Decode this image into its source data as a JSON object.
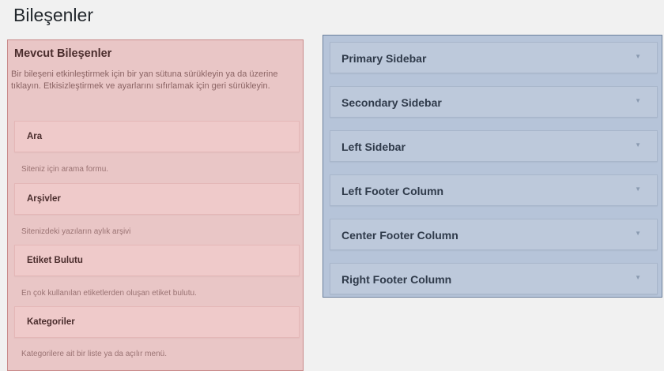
{
  "page": {
    "title": "Bileşenler"
  },
  "available": {
    "heading": "Mevcut Bileşenler",
    "description": "Bir bileşeni etkinleştirmek için bir yan sütuna sürükleyin ya da üzerine tıklayın. Etkisizleştirmek ve ayarlarını sıfırlamak için geri sürükleyin.",
    "widgets": [
      {
        "title": "Ara",
        "description": "Siteniz için arama formu."
      },
      {
        "title": "Arşivler",
        "description": "Sitenizdeki yazıların aylık arşivi"
      },
      {
        "title": "Etiket Bulutu",
        "description": "En çok kullanılan etiketlerden oluşan etiket bulutu."
      },
      {
        "title": "Kategoriler",
        "description": "Kategorilere ait bir liste ya da açılır menü."
      }
    ]
  },
  "sidebars": {
    "arrow_icon": "triangle-down-icon",
    "items": [
      {
        "label": "Primary Sidebar"
      },
      {
        "label": "Secondary Sidebar"
      },
      {
        "label": "Left Sidebar"
      },
      {
        "label": "Left Footer Column"
      },
      {
        "label": "Center Footer Column"
      },
      {
        "label": "Right Footer Column"
      }
    ]
  },
  "colors": {
    "available_bg": "#e9c6c6",
    "sidebars_bg": "#b6c4d9"
  }
}
